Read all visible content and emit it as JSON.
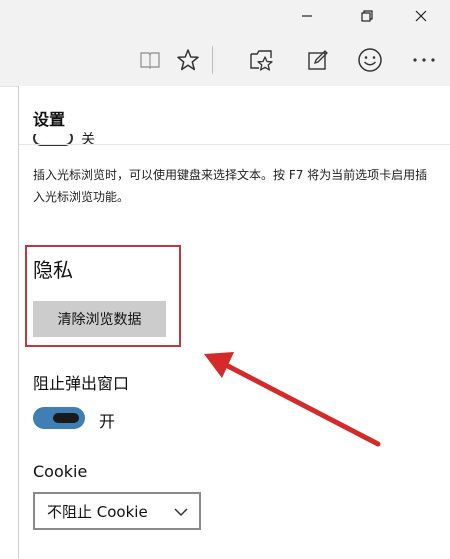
{
  "window": {
    "minimize_icon": "minimize-icon",
    "maximize_icon": "restore-icon",
    "close_icon": "close-icon"
  },
  "toolbar": {
    "icons": [
      "reading-view-icon",
      "favorite-star-icon",
      "hub-icon",
      "web-note-icon",
      "feedback-smiley-icon",
      "more-icon"
    ]
  },
  "settings": {
    "title": "设置",
    "caret_description": "插入光标浏览时，可以使用键盘来选择文本。按 F7 将为当前选项卡启用插入光标浏览功能。",
    "caret_toggle_state": "关",
    "privacy": {
      "heading": "隐私",
      "clear_button": "清除浏览数据"
    },
    "popup": {
      "label": "阻止弹出窗口",
      "toggle_state": "开"
    },
    "cookie": {
      "label": "Cookie",
      "selected": "不阻止 Cookie"
    }
  },
  "colors": {
    "highlight_box": "#c4363d",
    "arrow": "#d42a2a",
    "toggle_on": "#3f7fb5",
    "button_bg": "#cccccc"
  }
}
